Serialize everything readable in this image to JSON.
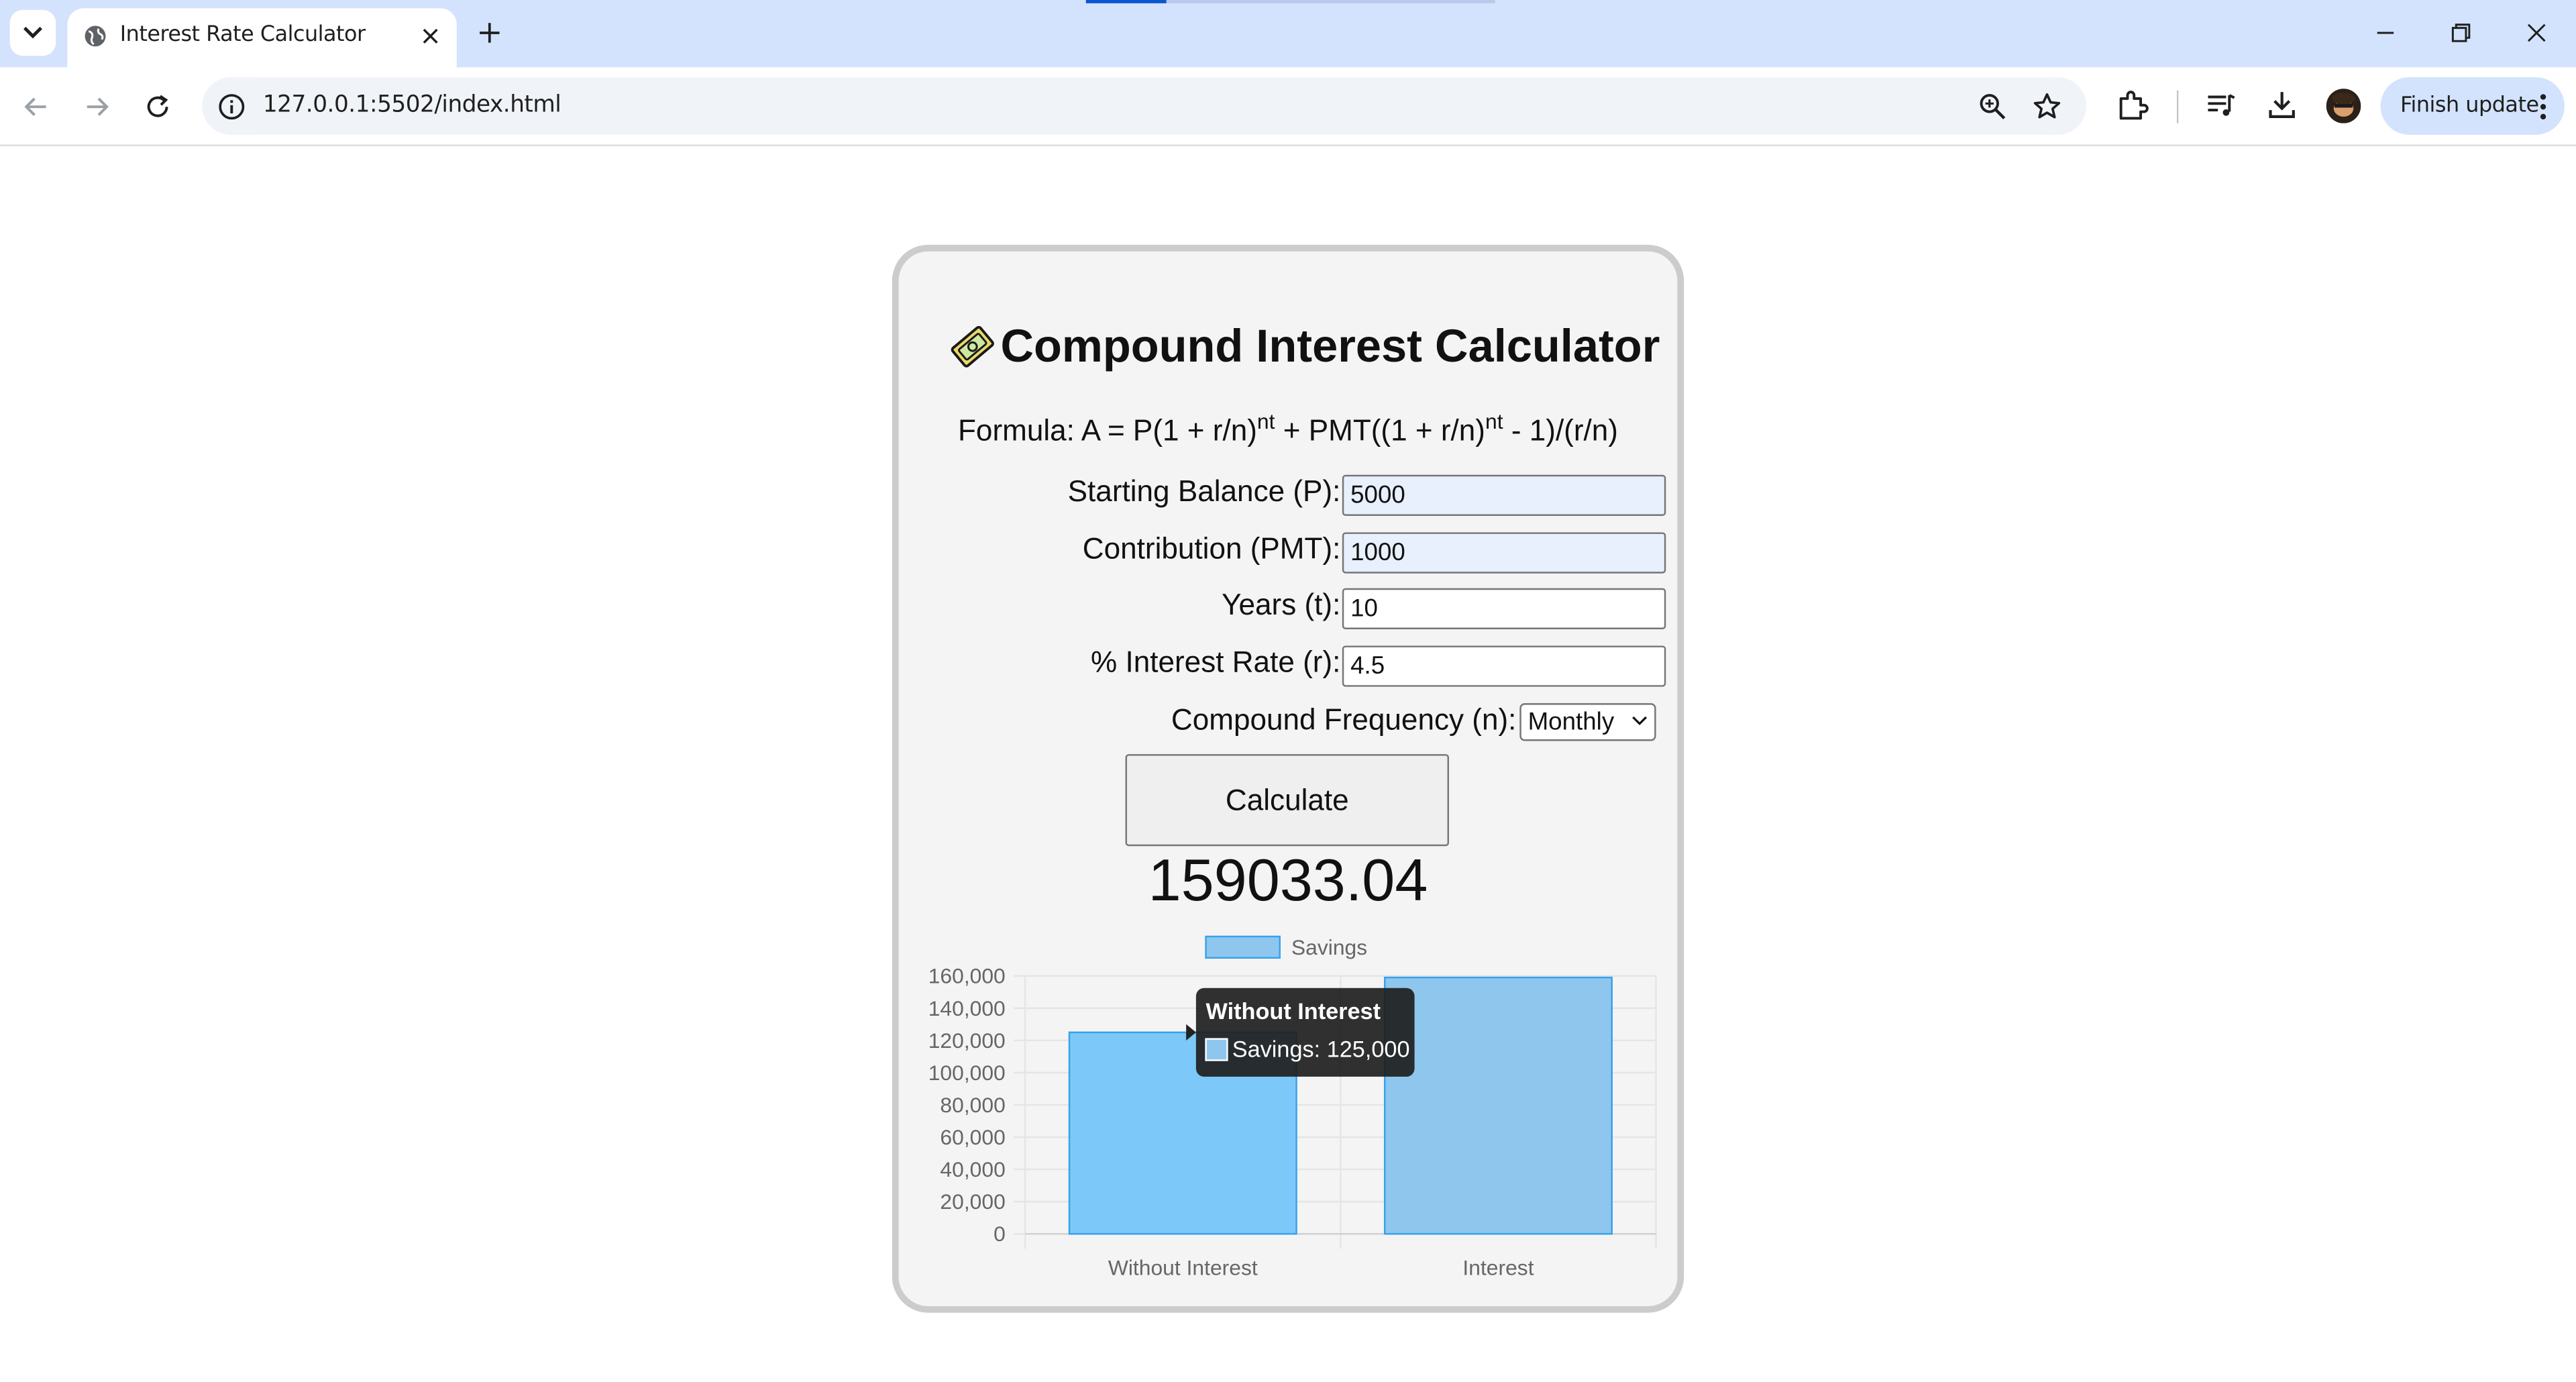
{
  "browser": {
    "tab_title": "Interest Rate Calculator",
    "url": "127.0.0.1:5502/index.html",
    "finish_update_label": "Finish update"
  },
  "page": {
    "title": "Compound Interest Calculator",
    "formula_prefix": "Formula: A = P(1 + r/n)",
    "formula_sup1": "nt",
    "formula_mid": " + PMT((1 + r/n)",
    "formula_sup2": "nt",
    "formula_suffix": " - 1)/(r/n)",
    "fields": {
      "starting_balance": {
        "label": "Starting Balance (P):",
        "value": "5000"
      },
      "contribution": {
        "label": "Contribution (PMT):",
        "value": "1000"
      },
      "years": {
        "label": "Years (t):",
        "value": "10"
      },
      "interest_rate": {
        "label": "% Interest Rate (r):",
        "value": "4.5"
      },
      "compound_frequency": {
        "label": "Compound Frequency (n):",
        "value": "Monthly"
      }
    },
    "calculate_label": "Calculate",
    "result": "159033.04"
  },
  "colors": {
    "bar_without_interest": "#7cc8f8",
    "bar_interest": "#8fc6ee",
    "bar_border": "#36a2eb"
  },
  "chart_data": {
    "type": "bar",
    "categories": [
      "Without Interest",
      "Interest"
    ],
    "series": [
      {
        "name": "Savings",
        "values": [
          125000,
          159033.04
        ]
      }
    ],
    "ylim": [
      0,
      160000
    ],
    "yticks": [
      "0",
      "20,000",
      "40,000",
      "60,000",
      "80,000",
      "100,000",
      "120,000",
      "140,000",
      "160,000"
    ],
    "legend": "top",
    "grid": true,
    "tooltip": {
      "title": "Without Interest",
      "text": "Savings: 125,000"
    }
  }
}
